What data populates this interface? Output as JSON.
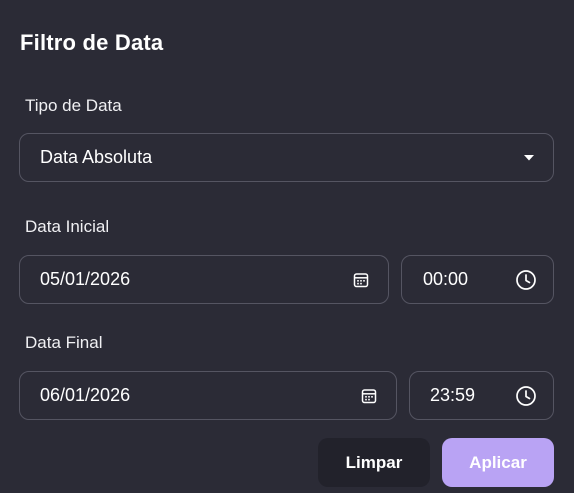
{
  "dialog": {
    "title": "Filtro de Data"
  },
  "date_type": {
    "label": "Tipo de Data",
    "selected": "Data Absoluta",
    "icon": "caret-down-icon"
  },
  "start": {
    "label": "Data Inicial",
    "date": "05/01/2026",
    "time": "00:00",
    "date_icon": "calendar-icon",
    "time_icon": "clock-icon"
  },
  "end": {
    "label": "Data Final",
    "date": "06/01/2026",
    "time": "23:59",
    "date_icon": "calendar-icon",
    "time_icon": "clock-icon"
  },
  "actions": {
    "clear_label": "Limpar",
    "apply_label": "Aplicar"
  },
  "colors": {
    "background": "#2b2b36",
    "border": "#555562",
    "clear_bg": "#22222b",
    "apply_bg": "#b9a3f4"
  }
}
